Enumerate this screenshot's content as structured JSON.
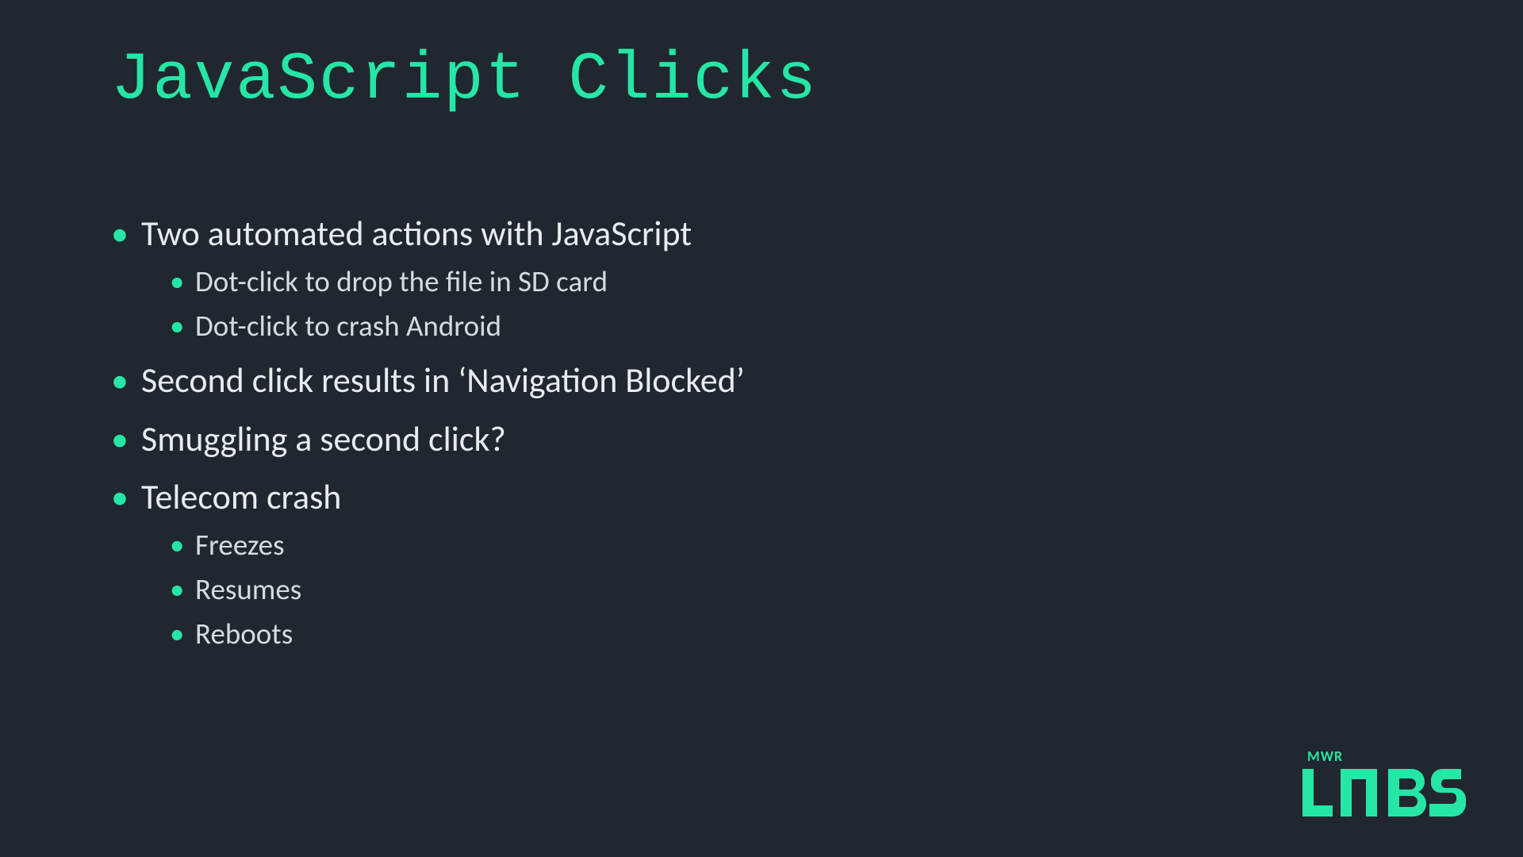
{
  "title": "JavaScript Clicks",
  "bullets": {
    "b0": "Two automated actions with JavaScript",
    "b0s0": "Dot-click to drop the file in SD card",
    "b0s1": "Dot-click to crash Android",
    "b1": "Second click results in ‘Navigation Blocked’",
    "b2": "Smuggling a second click?",
    "b3": "Telecom crash",
    "b3s0": "Freezes",
    "b3s1": "Resumes",
    "b3s2": "Reboots"
  },
  "logo": {
    "top_text": "MWR",
    "brand": "LABS"
  },
  "colors": {
    "background": "#20272f",
    "accent": "#26e6a5",
    "text": "#e8ecef"
  }
}
